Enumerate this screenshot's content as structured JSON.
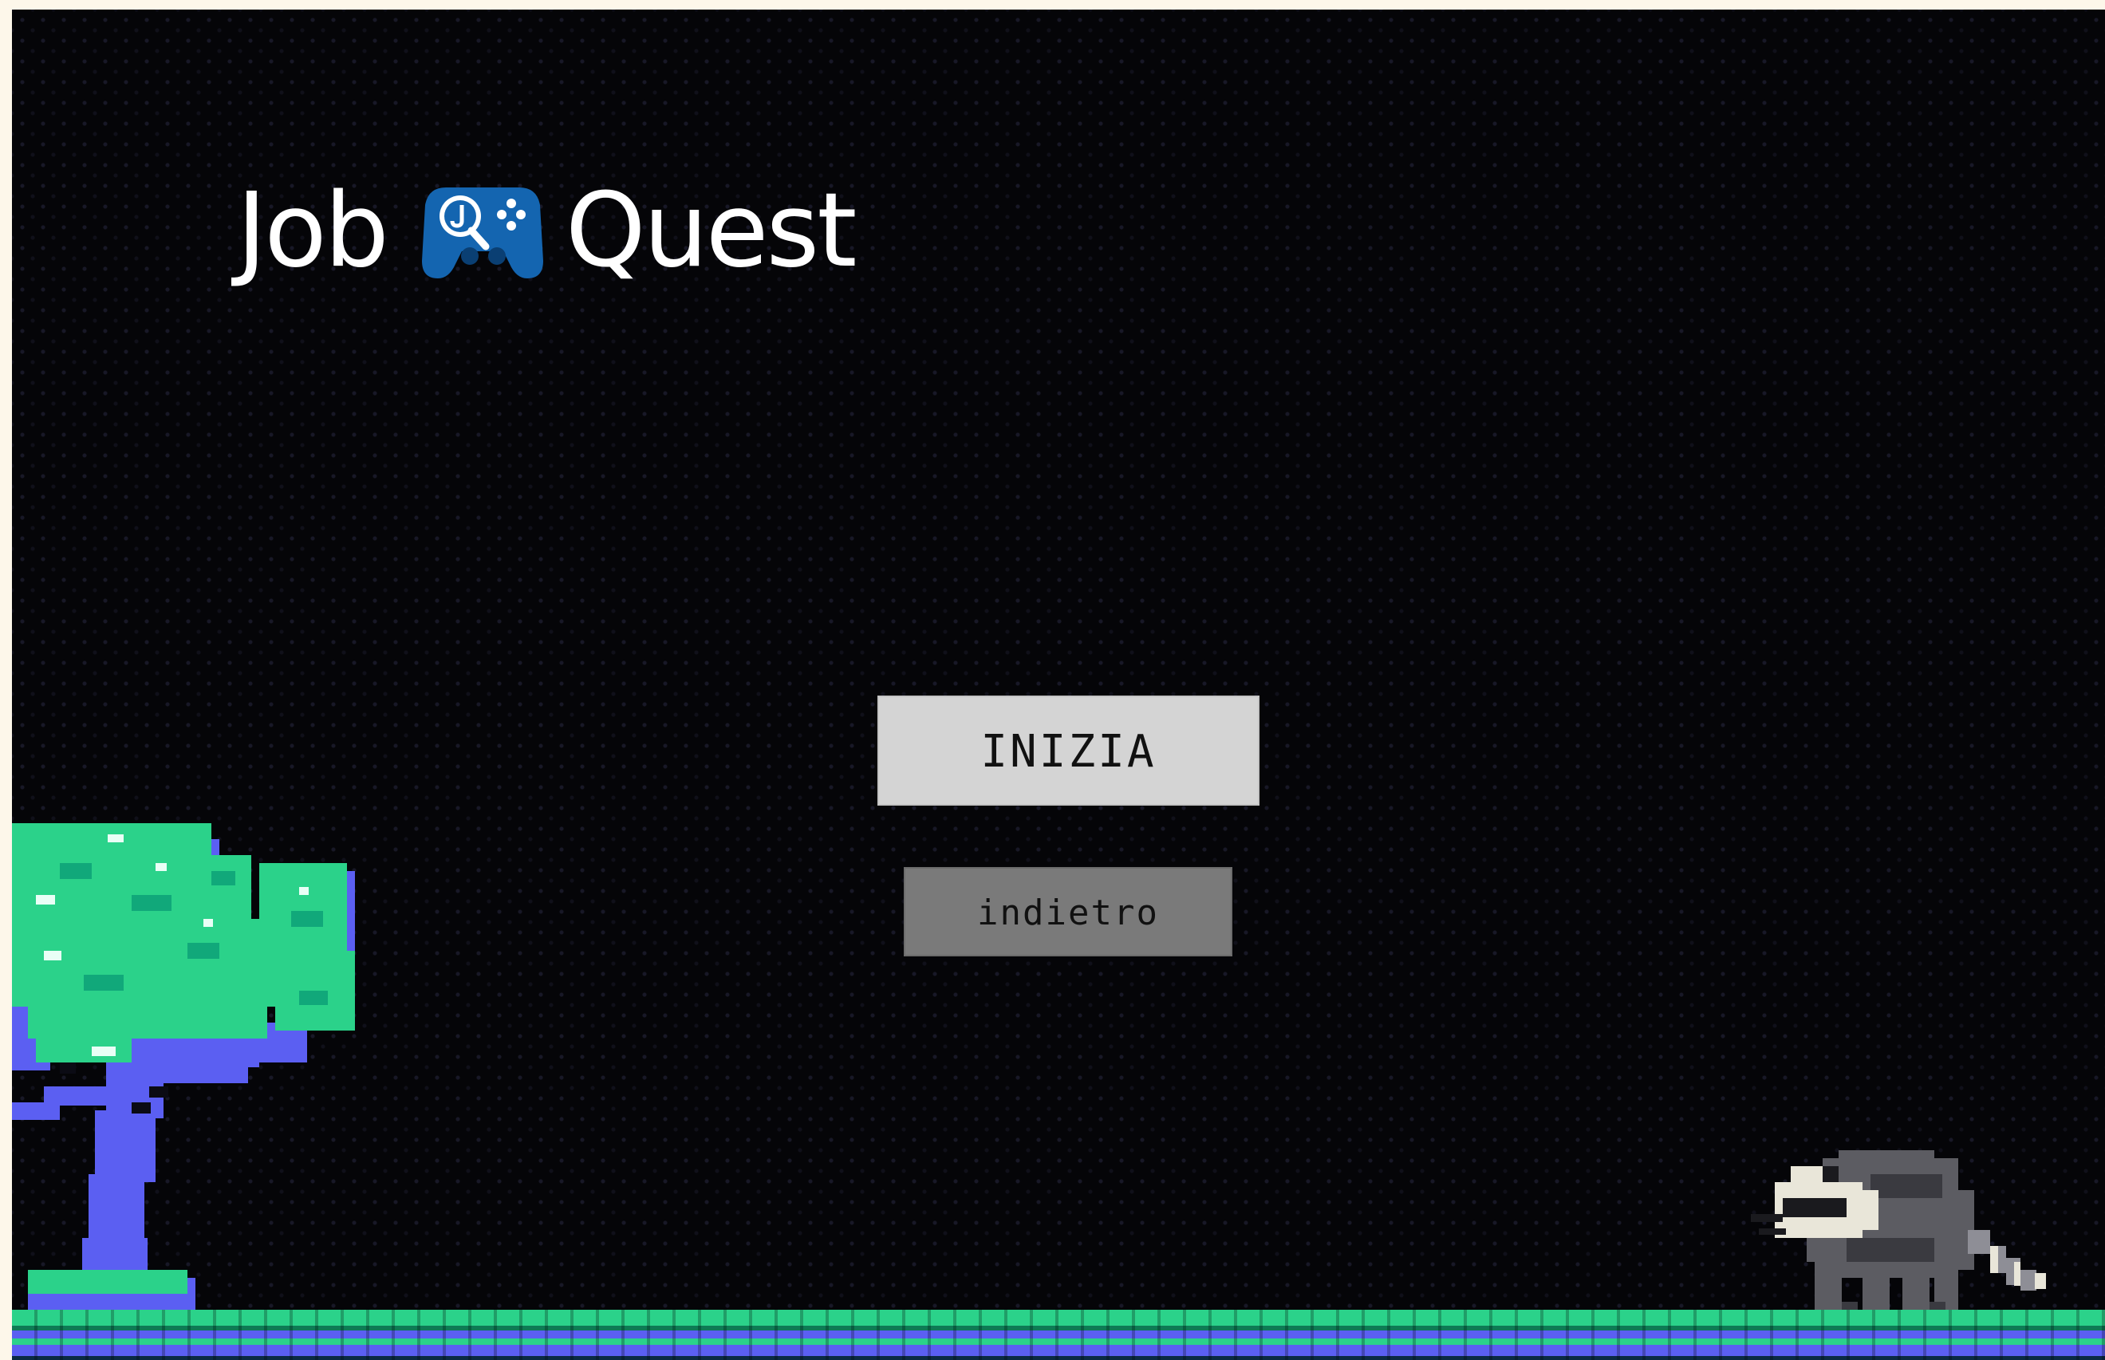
{
  "app": {
    "title_left": "Job",
    "title_right": "Quest",
    "logo_icon": "gamepad-magnifier-icon"
  },
  "menu": {
    "start_label": "INIZIA",
    "back_label": "indietro"
  },
  "colors": {
    "background": "#050508",
    "start_button": "#d4d4d4",
    "back_button": "#7a7a7a",
    "logo_blue": "#1465b0",
    "tree_leaves": "#2bd28a",
    "tree_trunk": "#5b5ff2",
    "ground_green": "#2bd28a",
    "ground_blue": "#5b5ff2"
  },
  "scene": {
    "sprites": [
      "pixel-tree",
      "raccoon-character"
    ]
  }
}
